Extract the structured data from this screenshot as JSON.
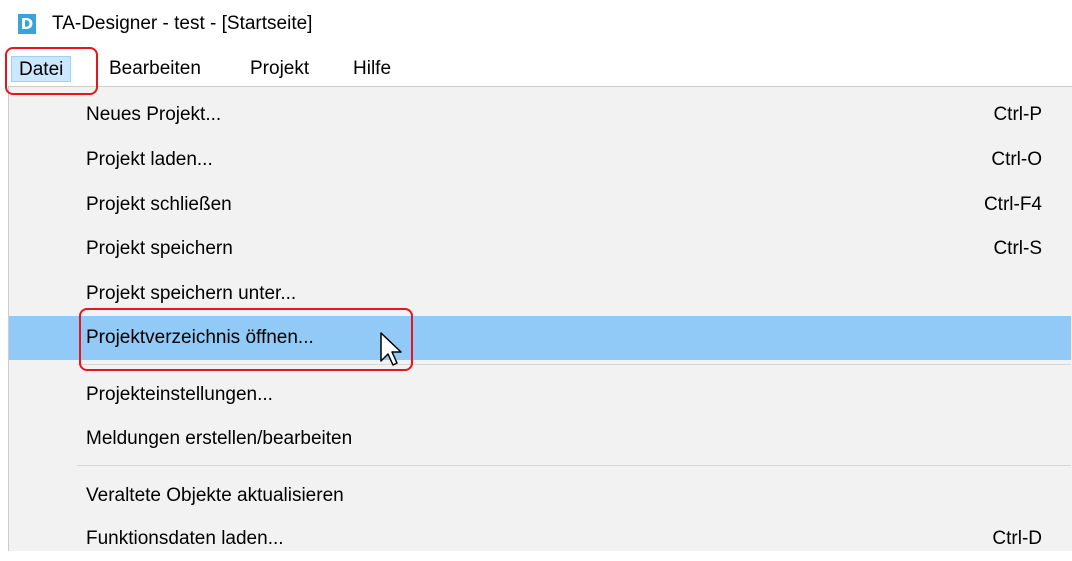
{
  "window": {
    "title": "TA-Designer - test - [Startseite]",
    "icon_letter": "D",
    "icon_color": "#3aa3d8"
  },
  "menubar": {
    "items": [
      {
        "label": "Datei",
        "active": true
      },
      {
        "label": "Bearbeiten"
      },
      {
        "label": "Projekt"
      },
      {
        "label": "Hilfe"
      }
    ]
  },
  "dropdown": {
    "items": [
      {
        "label": "Neues Projekt...",
        "shortcut": "Ctrl-P"
      },
      {
        "label": "Projekt laden...",
        "shortcut": "Ctrl-O"
      },
      {
        "label": "Projekt schließen",
        "shortcut": "Ctrl-F4"
      },
      {
        "label": "Projekt speichern",
        "shortcut": "Ctrl-S"
      },
      {
        "label": "Projekt speichern unter...",
        "shortcut": ""
      },
      {
        "label": "Projektverzeichnis öffnen...",
        "shortcut": "",
        "highlighted": true
      },
      {
        "label": "Projekteinstellungen...",
        "shortcut": ""
      },
      {
        "label": "Meldungen erstellen/bearbeiten",
        "shortcut": ""
      },
      {
        "label": "Veraltete Objekte aktualisieren",
        "shortcut": ""
      },
      {
        "label": "Funktionsdaten laden...",
        "shortcut": "Ctrl-D"
      }
    ]
  },
  "colors": {
    "highlight": "#91c9f7",
    "annotation": "#e8141e",
    "menu_bg": "#f2f2f2"
  }
}
